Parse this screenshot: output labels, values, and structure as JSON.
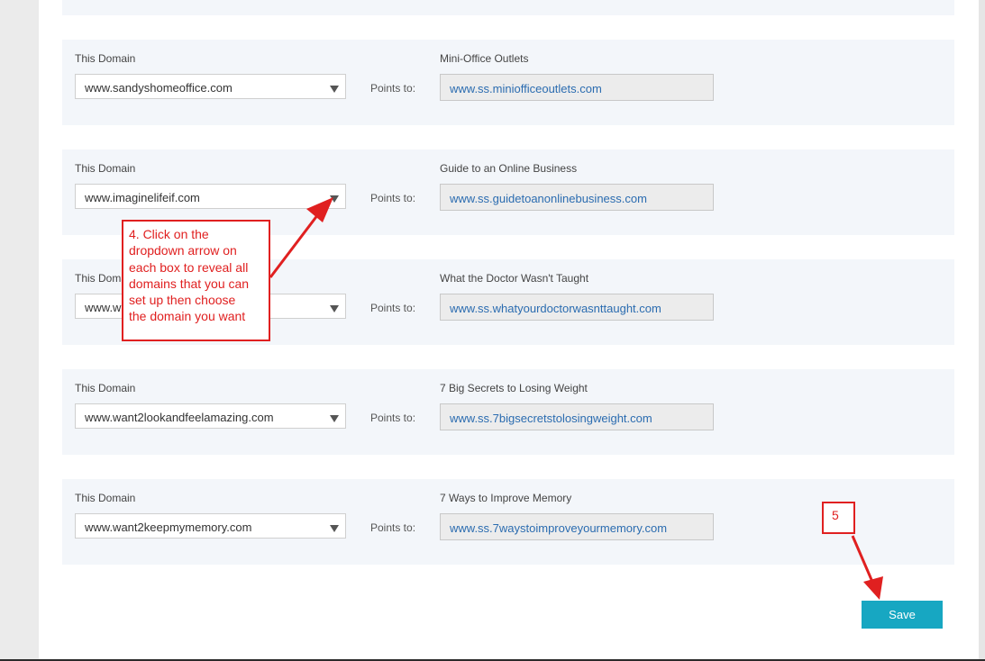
{
  "rows": [
    {
      "label": "This Domain",
      "domain": "www.sandyshomeoffice.com",
      "points_label": "Points to:",
      "target_title": "Mini-Office Outlets",
      "target_url": "www.ss.miniofficeoutlets.com"
    },
    {
      "label": "This Domain",
      "domain": "www.imaginelifeif.com",
      "points_label": "Points to:",
      "target_title": "Guide to an Online Business",
      "target_url": "www.ss.guidetoanonlinebusiness.com"
    },
    {
      "label": "This Domain",
      "domain": "www.w",
      "points_label": "Points to:",
      "target_title": "What the Doctor Wasn't Taught",
      "target_url": "www.ss.whatyourdoctorwasnttaught.com"
    },
    {
      "label": "This Domain",
      "domain": "www.want2lookandfeelamazing.com",
      "points_label": "Points to:",
      "target_title": "7 Big Secrets to Losing Weight",
      "target_url": "www.ss.7bigsecretstolosingweight.com"
    },
    {
      "label": "This Domain",
      "domain": "www.want2keepmymemory.com",
      "points_label": "Points to:",
      "target_title": "7 Ways to Improve Memory",
      "target_url": "www.ss.7waystoimproveyourmemory.com"
    }
  ],
  "callout": {
    "lines": [
      "4. Click on the",
      "dropdown arrow on",
      "each box to reveal all",
      "domains that you can",
      "set up then choose",
      "the domain you want"
    ]
  },
  "step5": {
    "text": "5"
  },
  "save_label": "Save",
  "colors": {
    "annotation": "#e02020",
    "save_button": "#17a7c2",
    "link": "#2b6cb0",
    "panel": "#f3f6fa"
  },
  "icons": {
    "dropdown": "triangle-down"
  }
}
